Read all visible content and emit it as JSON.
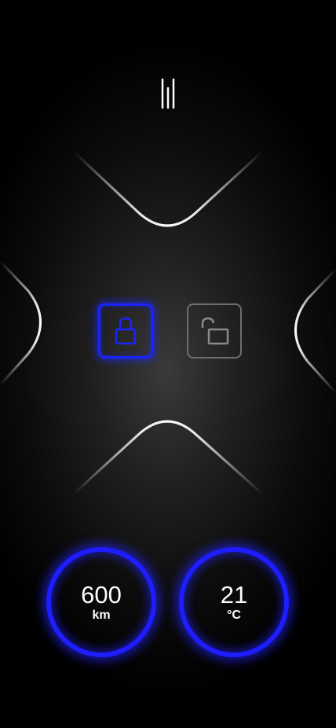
{
  "menu": {
    "icon": "menu-bars-icon"
  },
  "lock_controls": {
    "lock": {
      "icon": "lock-closed-icon",
      "state": "active",
      "color": "#1a24ff"
    },
    "unlock": {
      "icon": "lock-open-icon",
      "state": "inactive",
      "color": "#6e6e6e"
    }
  },
  "gauges": {
    "range": {
      "value": "600",
      "unit": "km"
    },
    "temperature": {
      "value": "21",
      "unit": "°C"
    }
  },
  "colors": {
    "accent": "#1d1dff",
    "background": "#000000",
    "outline": "#ffffff"
  }
}
